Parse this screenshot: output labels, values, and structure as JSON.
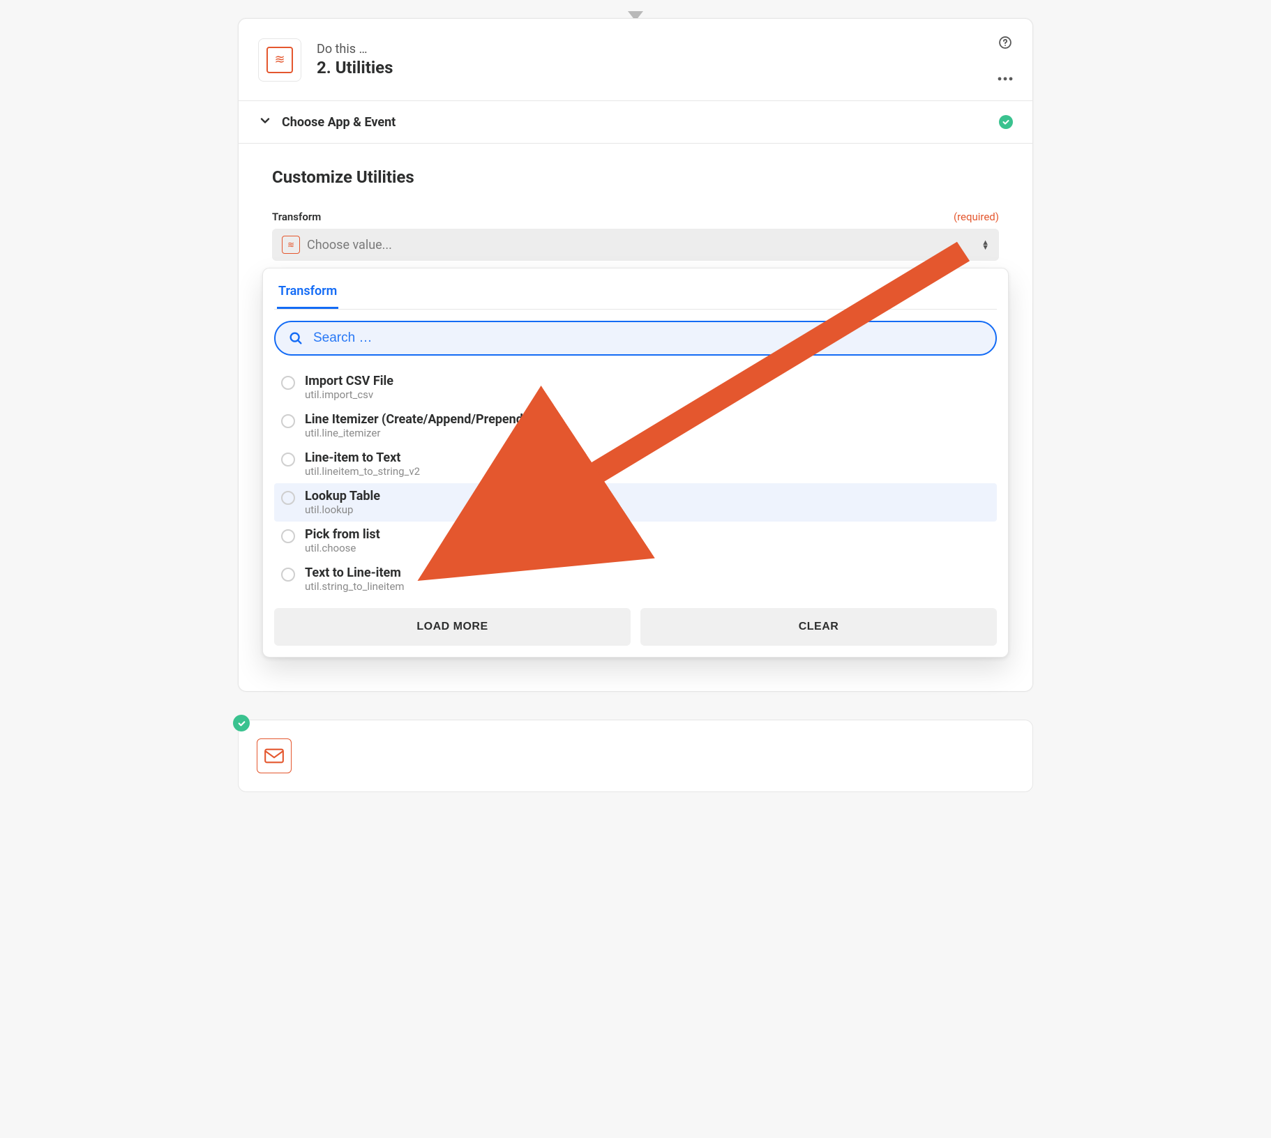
{
  "header": {
    "subtitle": "Do this …",
    "title": "2. Utilities",
    "help_icon": "help-circle-icon",
    "more_icon": "more-horizontal-icon",
    "app_icon": "wave-icon"
  },
  "section": {
    "chevron_icon": "chevron-down-icon",
    "label": "Choose App & Event",
    "status_icon": "check-icon"
  },
  "body": {
    "title": "Customize Utilities",
    "field_label": "Transform",
    "required_label": "(required)",
    "select": {
      "icon": "wave-icon",
      "placeholder": "Choose value...",
      "caret_icon": "sort-carets-icon"
    }
  },
  "dropdown": {
    "tab_label": "Transform",
    "search_placeholder": "Search …",
    "search_icon": "search-icon",
    "options": [
      {
        "title": "Import CSV File",
        "sub": "util.import_csv",
        "highlight": false
      },
      {
        "title": "Line Itemizer (Create/Append/Prepend)",
        "sub": "util.line_itemizer",
        "highlight": false
      },
      {
        "title": "Line-item to Text",
        "sub": "util.lineitem_to_string_v2",
        "highlight": false
      },
      {
        "title": "Lookup Table",
        "sub": "util.lookup",
        "highlight": true
      },
      {
        "title": "Pick from list",
        "sub": "util.choose",
        "highlight": false
      },
      {
        "title": "Text to Line-item",
        "sub": "util.string_to_lineitem",
        "highlight": false
      }
    ],
    "buttons": {
      "load_more": "LOAD MORE",
      "clear": "CLEAR"
    }
  },
  "bg_card": {
    "status_icon": "check-icon",
    "icon": "mail-icon"
  },
  "colors": {
    "accent": "#e4572e",
    "primary": "#136bf5",
    "success": "#3ac28f"
  },
  "annotation": {
    "type": "arrow",
    "points_to": "option Lookup Table"
  }
}
